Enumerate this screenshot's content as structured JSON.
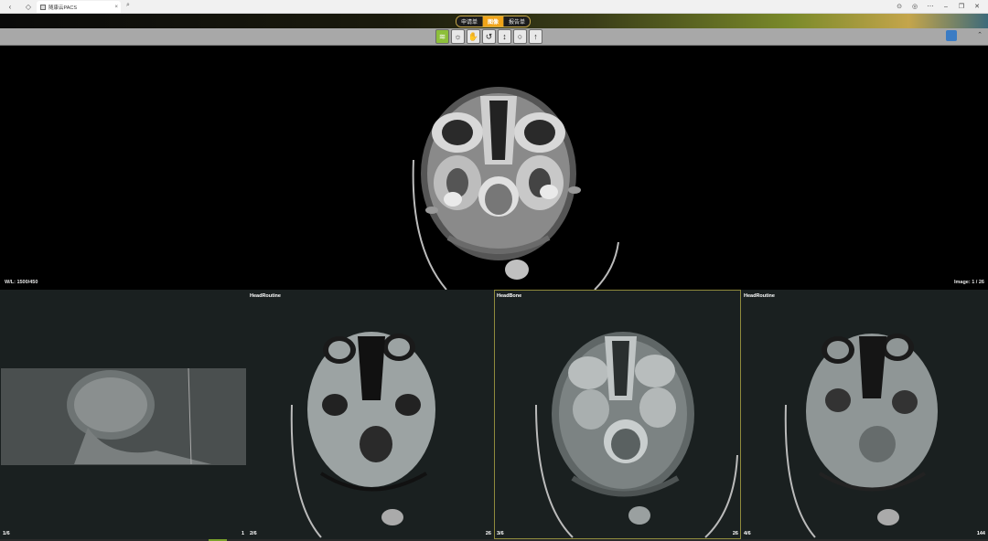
{
  "browser": {
    "tab_title": "随康云PACS",
    "right_icons": [
      "download-icon",
      "globe-icon",
      "more-icon",
      "minimize-icon",
      "restore-icon",
      "close-icon"
    ]
  },
  "header": {
    "segments": [
      "申请单",
      "图像",
      "报告单"
    ],
    "active_segment": 1,
    "accent_color": "#f0a419"
  },
  "toolbar": {
    "tools": [
      "layers-icon",
      "brightness-icon",
      "hand-icon",
      "rotate-icon",
      "scroll-icon",
      "circle-icon",
      "arrow-icon"
    ],
    "active_tool": 0
  },
  "main_view": {
    "window_level": "W/L: 1500/450",
    "image_index": "Image: 1 / 26"
  },
  "thumbnails": [
    {
      "series": "",
      "index_left": "1/6",
      "count_right": "1"
    },
    {
      "series": "HeadRoutine",
      "index_left": "2/6",
      "count_right": "26"
    },
    {
      "series": "HeadBone",
      "index_left": "3/6",
      "count_right": "26"
    },
    {
      "series": "HeadRoutine",
      "index_left": "4/6",
      "count_right": "144"
    }
  ],
  "selected_thumbnail": 2
}
